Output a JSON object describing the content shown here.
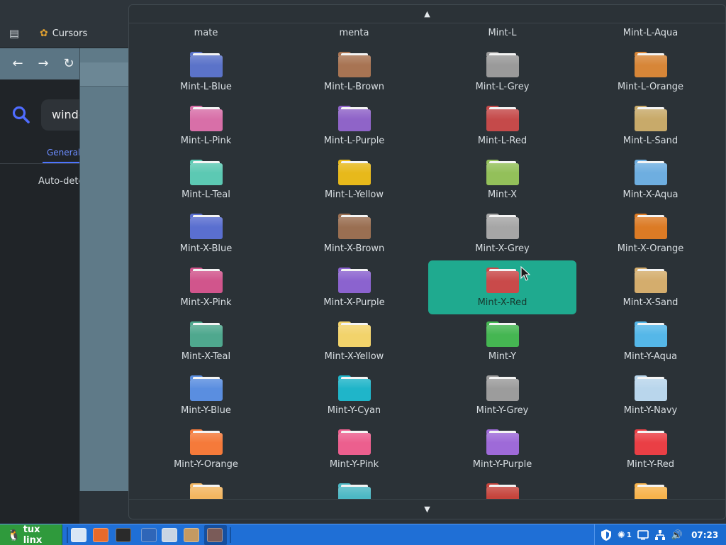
{
  "browser": {
    "tab_title": "Cursors",
    "search_value": "windows",
    "general_tab_label": "General",
    "auto_detect_text": "Auto-detect"
  },
  "popup": {
    "scroll_up_icon": "triangle-up-icon",
    "scroll_down_icon": "triangle-down-icon",
    "selected": "Mint-X-Red",
    "items": [
      {
        "label": "mate",
        "color": "#c9c59a"
      },
      {
        "label": "menta",
        "color": "#a9b98a"
      },
      {
        "label": "Mint-L",
        "color": "#8fb85e"
      },
      {
        "label": "Mint-L-Aqua",
        "color": "#6fb2d6"
      },
      {
        "label": "Mint-L-Blue",
        "color": "#5b73c9"
      },
      {
        "label": "Mint-L-Brown",
        "color": "#a87453"
      },
      {
        "label": "Mint-L-Grey",
        "color": "#9a9a9a"
      },
      {
        "label": "Mint-L-Orange",
        "color": "#d78638"
      },
      {
        "label": "Mint-L-Pink",
        "color": "#d86fa8"
      },
      {
        "label": "Mint-L-Purple",
        "color": "#8f64c8"
      },
      {
        "label": "Mint-L-Red",
        "color": "#c54a4a"
      },
      {
        "label": "Mint-L-Sand",
        "color": "#c8aa6a"
      },
      {
        "label": "Mint-L-Teal",
        "color": "#5cc9b3"
      },
      {
        "label": "Mint-L-Yellow",
        "color": "#e7b91b"
      },
      {
        "label": "Mint-X",
        "color": "#93c05a"
      },
      {
        "label": "Mint-X-Aqua",
        "color": "#6eaee0"
      },
      {
        "label": "Mint-X-Blue",
        "color": "#5a6fd0"
      },
      {
        "label": "Mint-X-Brown",
        "color": "#9a6f52"
      },
      {
        "label": "Mint-X-Grey",
        "color": "#a6a6a6"
      },
      {
        "label": "Mint-X-Orange",
        "color": "#dc7b25"
      },
      {
        "label": "Mint-X-Pink",
        "color": "#d1558c"
      },
      {
        "label": "Mint-X-Purple",
        "color": "#8b63cf"
      },
      {
        "label": "Mint-X-Red",
        "color": "#c94a4a"
      },
      {
        "label": "Mint-X-Sand",
        "color": "#d4ad6d"
      },
      {
        "label": "Mint-X-Teal",
        "color": "#4fa88e"
      },
      {
        "label": "Mint-X-Yellow",
        "color": "#f2d36b"
      },
      {
        "label": "Mint-Y",
        "color": "#45b652"
      },
      {
        "label": "Mint-Y-Aqua",
        "color": "#55b7e8"
      },
      {
        "label": "Mint-Y-Blue",
        "color": "#5a8ee0"
      },
      {
        "label": "Mint-Y-Cyan",
        "color": "#1fb5c9"
      },
      {
        "label": "Mint-Y-Grey",
        "color": "#9c9c9c"
      },
      {
        "label": "Mint-Y-Navy",
        "color": "#b9d6ec"
      },
      {
        "label": "Mint-Y-Orange",
        "color": "#f57a3a"
      },
      {
        "label": "Mint-Y-Pink",
        "color": "#ec5f8e"
      },
      {
        "label": "Mint-Y-Purple",
        "color": "#9e6ad8"
      },
      {
        "label": "Mint-Y-Red",
        "color": "#ea3f45"
      },
      {
        "label": "",
        "color": "#f3b660"
      },
      {
        "label": "",
        "color": "#4cb8c4"
      },
      {
        "label": "",
        "color": "#c6443c"
      },
      {
        "label": "",
        "color": "#f7b34b"
      }
    ]
  },
  "taskbar": {
    "start_label": "tux linx",
    "start_icon": "tux-icon",
    "launchers": [
      {
        "name": "file-manager-icon",
        "color": "#d9e6f5"
      },
      {
        "name": "firefox-icon",
        "color": "#e86a2a"
      },
      {
        "name": "terminal-icon",
        "color": "#2a2a2a"
      },
      {
        "name": "lock-app-icon",
        "color": "#2f66b8"
      },
      {
        "name": "network-app-icon",
        "color": "#c9d5e3"
      },
      {
        "name": "package-icon",
        "color": "#c49a62"
      },
      {
        "name": "window-app-icon",
        "color": "#7a5b58"
      }
    ],
    "tray": {
      "shield_icon": "shield-icon",
      "notification_count": "1",
      "clock": "07:23"
    }
  }
}
